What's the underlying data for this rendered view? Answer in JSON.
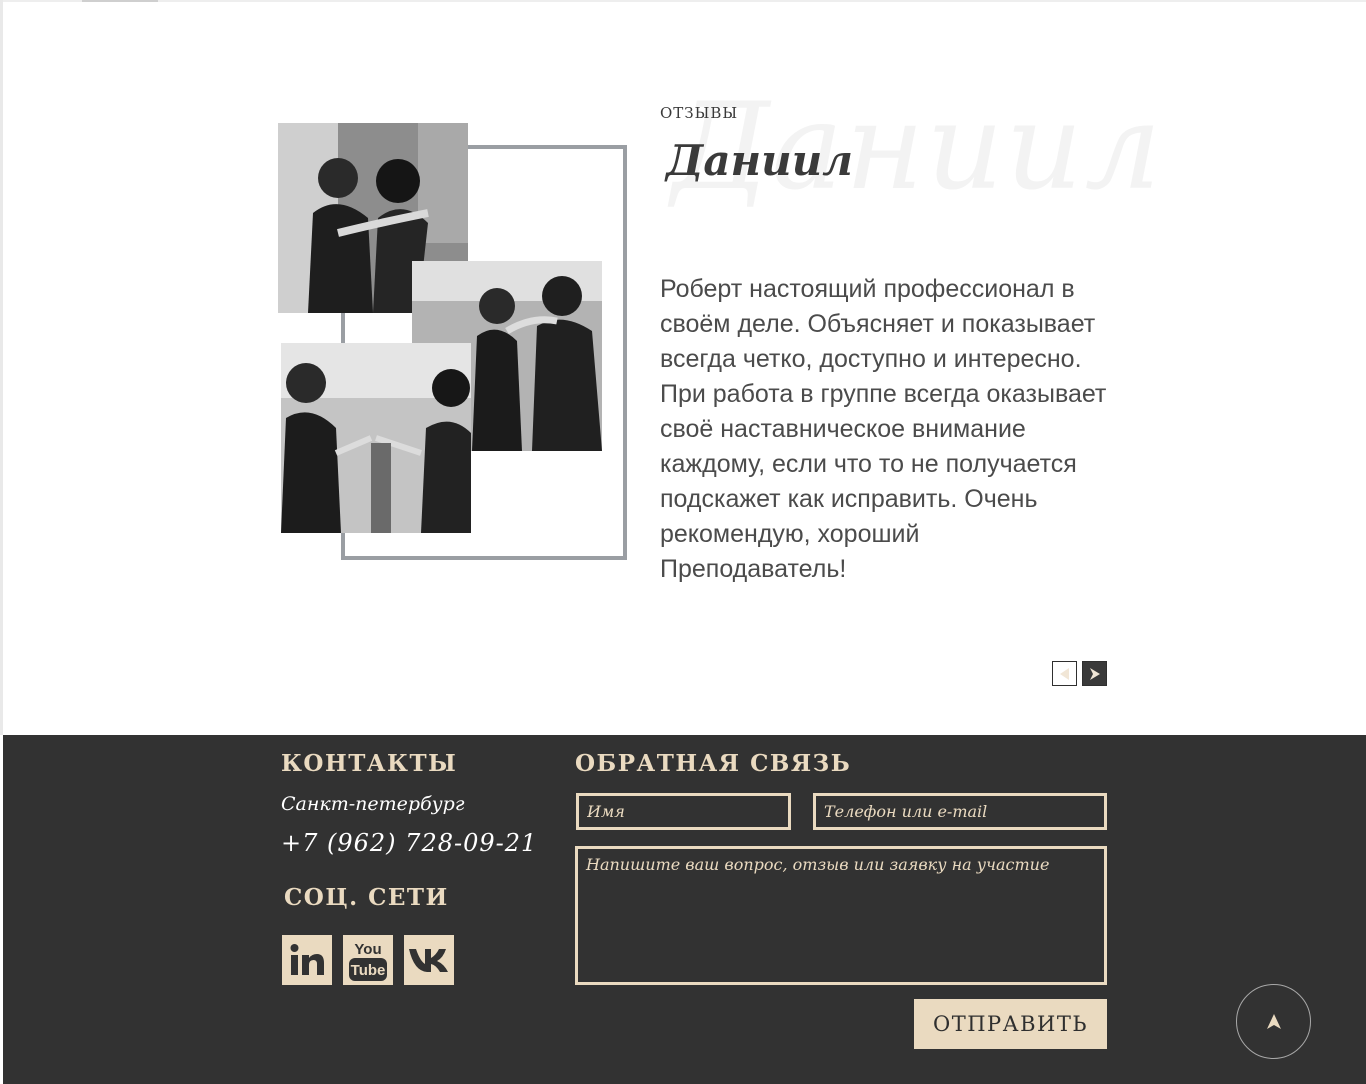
{
  "reviews": {
    "section_label": "отзывы",
    "reviewer_name": "Даниил",
    "reviewer_watermark": "Даниил",
    "text": "Роберт настоящий профессионал в своём деле. Объясняет и показывает всегда четко, доступно и интересно. При работа в группе всегда оказывает своё наставническое внимание каждому, если что то не получается подскажет как исправить. Очень рекомендую, хороший Преподаватель!",
    "prev_icon": "triangle-left-icon",
    "next_icon": "triangle-right-icon"
  },
  "footer": {
    "contacts_heading": "Контакты",
    "city": "Санкт-петербург",
    "phone": "+7 (962) 728-09-21",
    "social_heading": "Соц. сети",
    "social": {
      "linkedin": "in",
      "youtube_top": "You",
      "youtube_bottom": "Tube",
      "vk": "vk"
    },
    "feedback_heading": "Обратная связь",
    "form": {
      "name_placeholder": "Имя",
      "contact_placeholder": "Телефон или e-mail",
      "message_placeholder": "Напишите ваш вопрос, отзыв или заявку на участие",
      "submit_label": "Отправить"
    },
    "scroll_top_icon": "arrow-up-icon"
  },
  "colors": {
    "footer_bg": "#323232",
    "accent_beige": "#eadac0",
    "text_dark": "#3a3a3a",
    "frame_gray": "#9a9ea3"
  }
}
